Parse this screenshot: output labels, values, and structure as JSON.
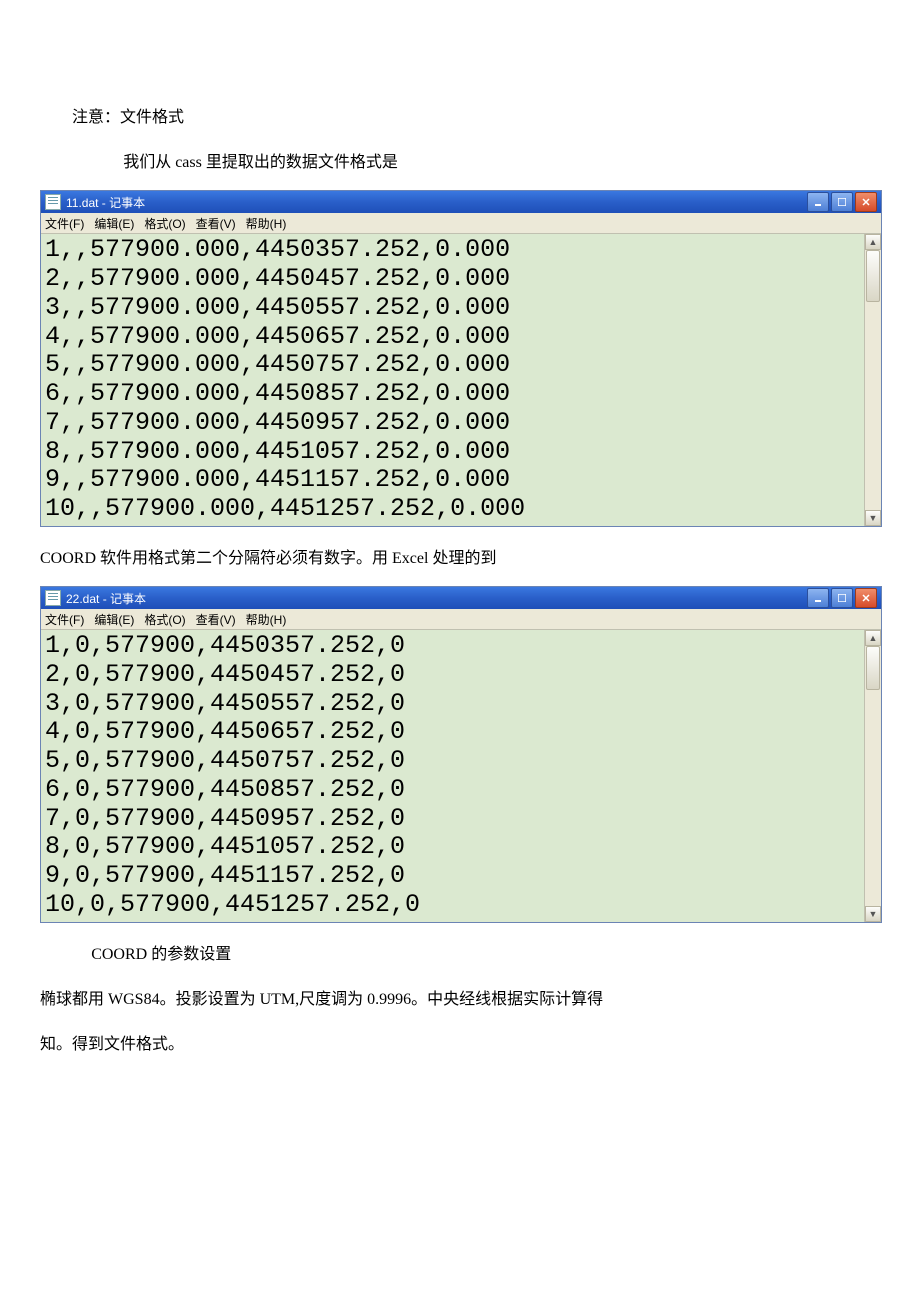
{
  "paragraphs": {
    "p1": "注意：文件格式",
    "p2_before": "我们从 ",
    "p2_latin": "cass",
    "p2_after": " 里提取出的数据文件格式是",
    "p3_a": "COORD",
    "p3_mid": " 软件用格式第二个分隔符必须有数字。用 ",
    "p3_b": "Excel",
    "p3_after": " 处理的到",
    "p4_a": "COORD",
    "p4_after": " 的参数设置",
    "p5_part1": "椭球都用 ",
    "p5_wgs": "WGS84",
    "p5_part2": "。投影设置为 ",
    "p5_utm": "UTM,",
    "p5_part3": "尺度调为 ",
    "p5_num": "0.9996",
    "p5_part4": "。中央经线根据实际计算得",
    "p5_line2": "知。得到文件格式。"
  },
  "notepad1": {
    "title": "11.dat - 记事本",
    "menus": {
      "file": "文件(F)",
      "edit": "编辑(E)",
      "format": "格式(O)",
      "view": "查看(V)",
      "help": "帮助(H)"
    },
    "content": "1,,577900.000,4450357.252,0.000\n2,,577900.000,4450457.252,0.000\n3,,577900.000,4450557.252,0.000\n4,,577900.000,4450657.252,0.000\n5,,577900.000,4450757.252,0.000\n6,,577900.000,4450857.252,0.000\n7,,577900.000,4450957.252,0.000\n8,,577900.000,4451057.252,0.000\n9,,577900.000,4451157.252,0.000\n10,,577900.000,4451257.252,0.000"
  },
  "notepad2": {
    "title": "22.dat - 记事本",
    "menus": {
      "file": "文件(F)",
      "edit": "编辑(E)",
      "format": "格式(O)",
      "view": "查看(V)",
      "help": "帮助(H)"
    },
    "content": "1,0,577900,4450357.252,0\n2,0,577900,4450457.252,0\n3,0,577900,4450557.252,0\n4,0,577900,4450657.252,0\n5,0,577900,4450757.252,0\n6,0,577900,4450857.252,0\n7,0,577900,4450957.252,0\n8,0,577900,4451057.252,0\n9,0,577900,4451157.252,0\n10,0,577900,4451257.252,0"
  }
}
